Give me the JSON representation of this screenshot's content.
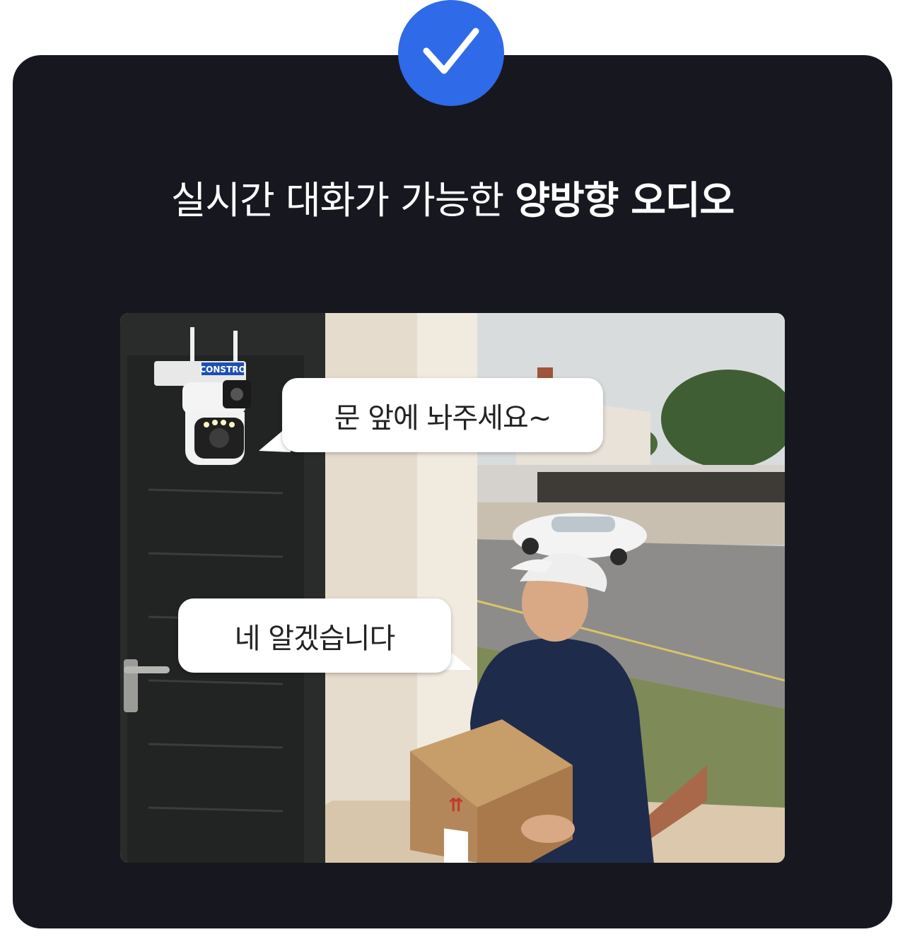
{
  "header": {
    "check_icon": "check-icon",
    "badge_color": "#2f6ae8",
    "headline_regular": "실시간 대화가 가능한 ",
    "headline_bold": "양방향 오디오"
  },
  "scene": {
    "camera_brand_label": "CONSTRO",
    "bubble_camera": "문 앞에 놔주세요~",
    "bubble_courier": "네 알겠습니다"
  },
  "colors": {
    "card_background": "#17181f",
    "accent": "#2f6ae8"
  }
}
